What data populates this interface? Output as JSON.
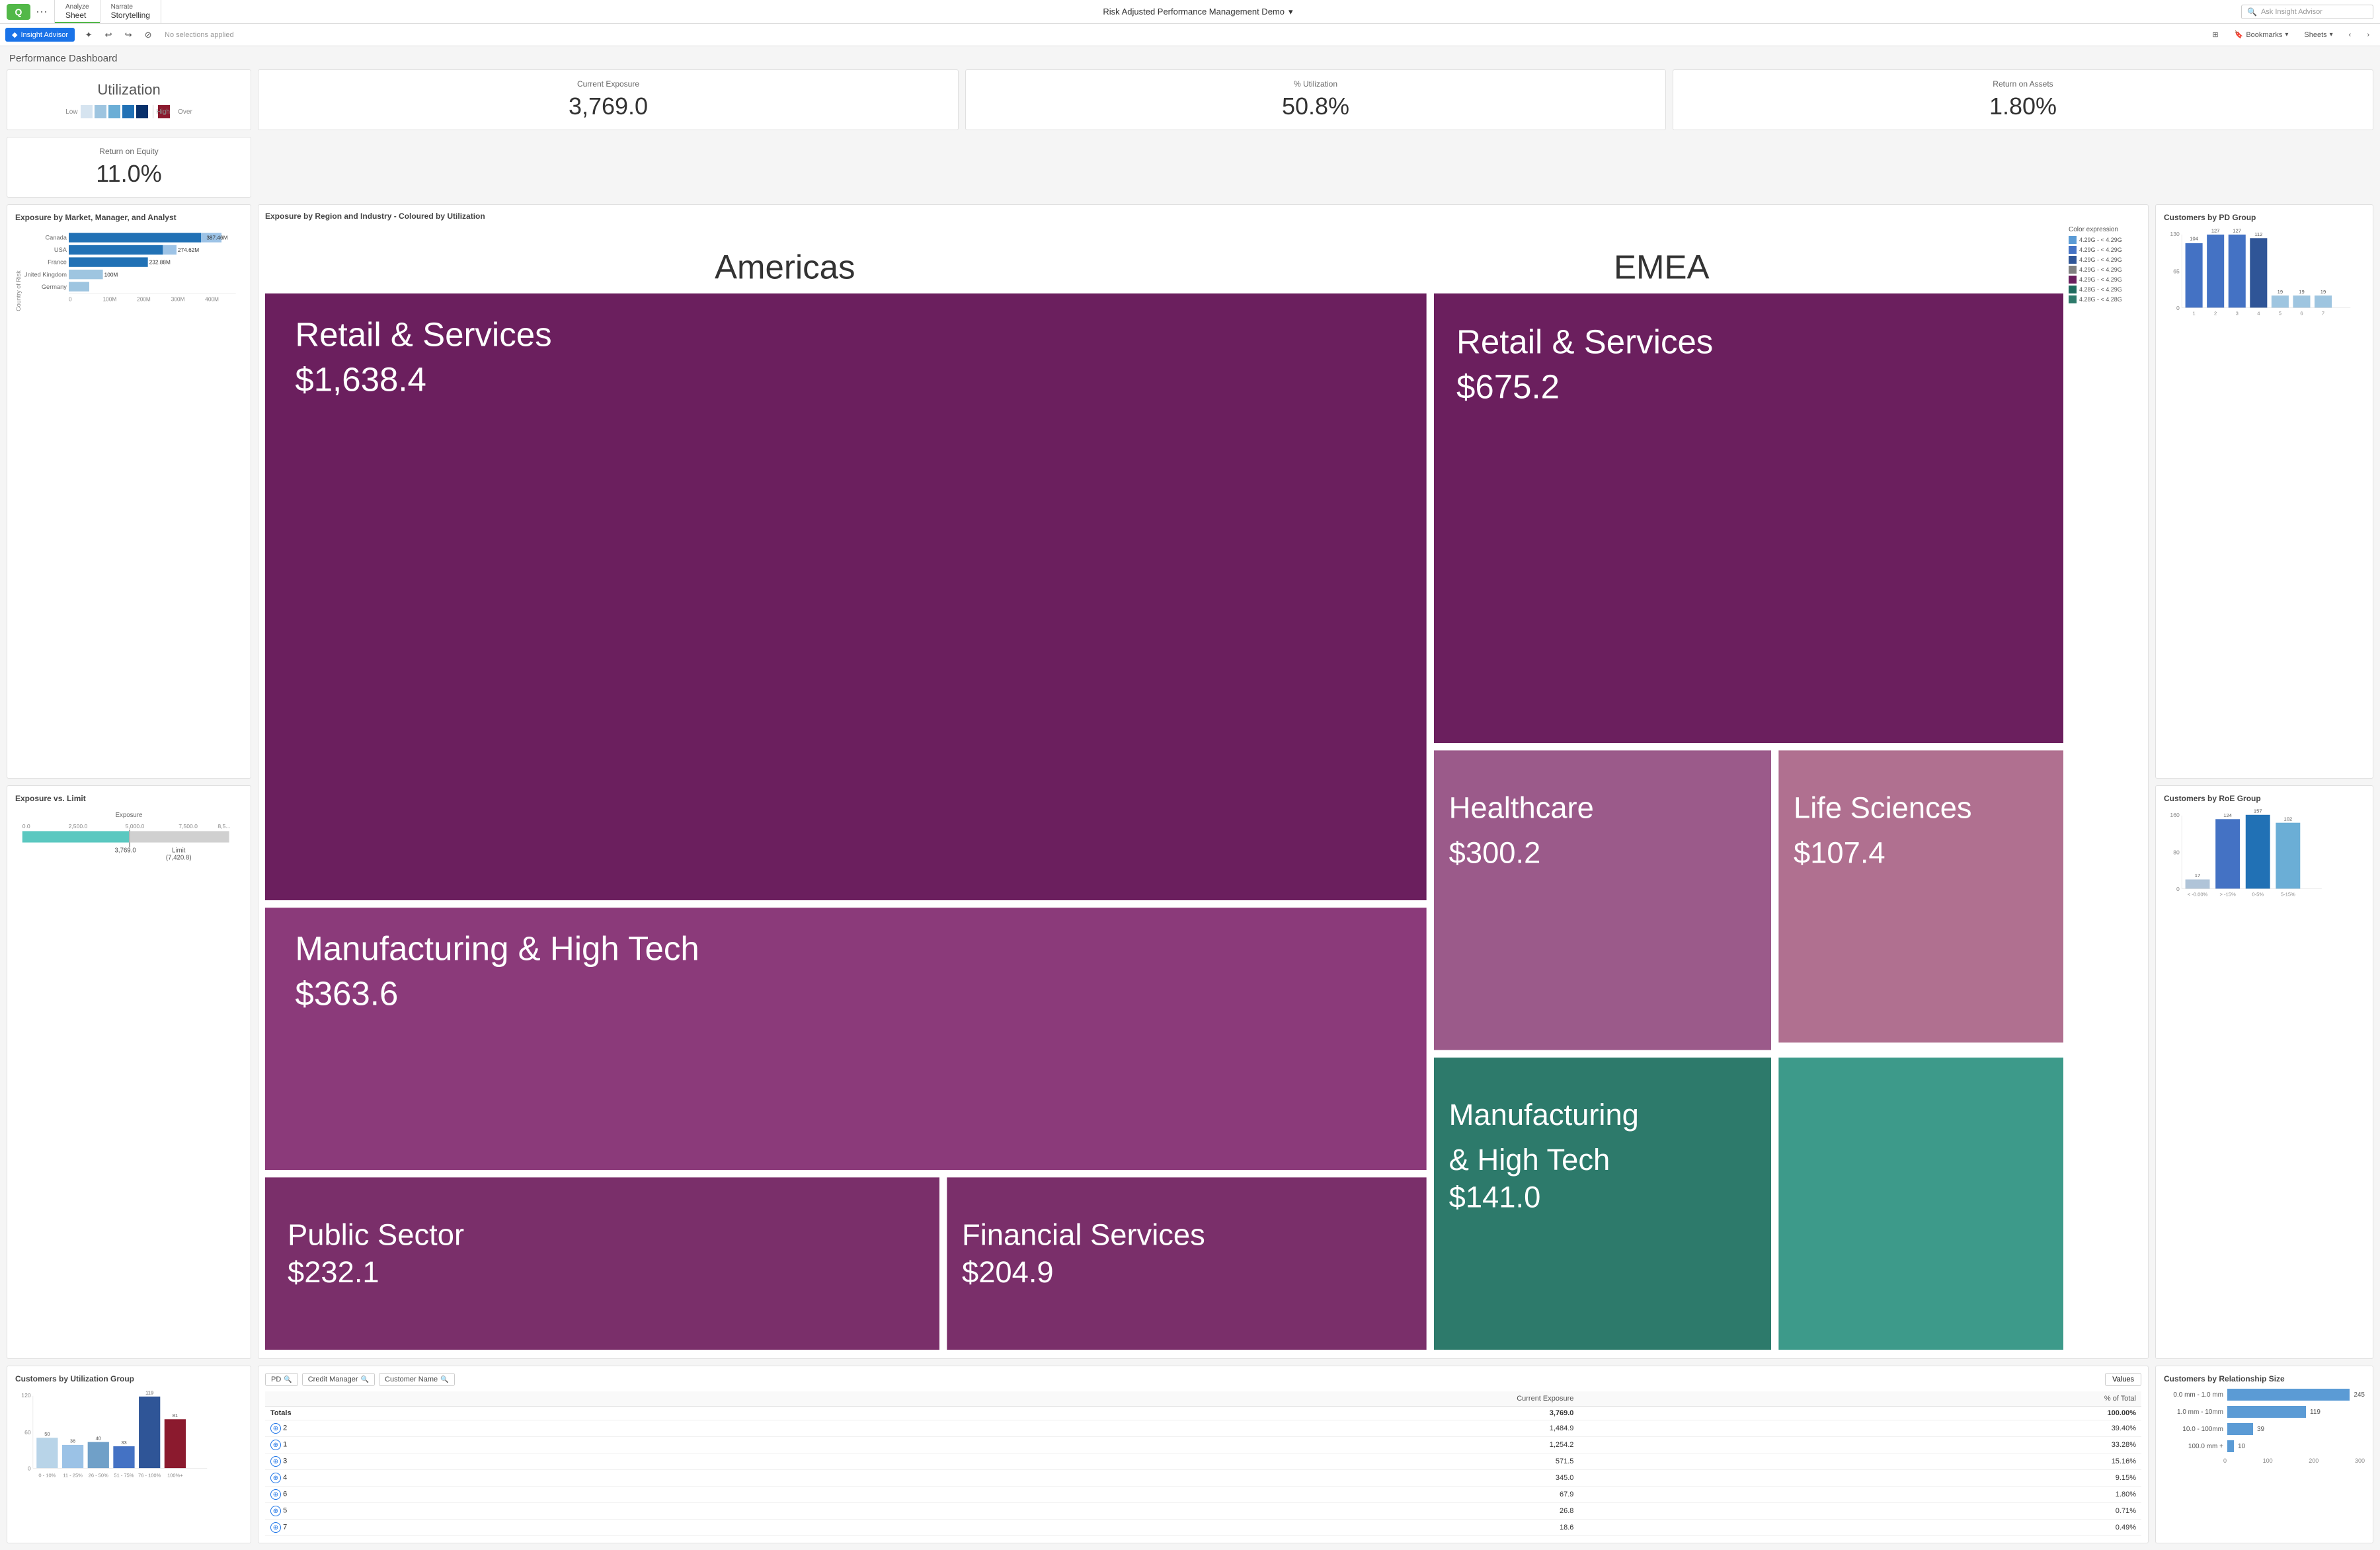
{
  "topNav": {
    "logo": "Q",
    "tabs": [
      {
        "top": "Analyze",
        "bottom": "Sheet",
        "active": true
      },
      {
        "top": "Narrate",
        "bottom": "Storytelling",
        "active": false
      }
    ],
    "title": "Risk Adjusted Performance Management Demo",
    "searchPlaceholder": "Ask Insight Advisor"
  },
  "toolbar": {
    "insightAdvisorLabel": "Insight Advisor",
    "noSelections": "No selections applied"
  },
  "bookmarks": "Bookmarks",
  "sheets": "Sheets",
  "pageTitle": "Performance Dashboard",
  "utilizationCard": {
    "title": "Utilization",
    "legend": {
      "low": "Low",
      "high": "High",
      "over": "Over"
    }
  },
  "kpis": [
    {
      "label": "Current Exposure",
      "value": "3,769.0"
    },
    {
      "label": "% Utilization",
      "value": "50.8%"
    },
    {
      "label": "Return on Assets",
      "value": "1.80%"
    },
    {
      "label": "Return on Equity",
      "value": "11.0%"
    }
  ],
  "exposureByMarket": {
    "title": "Exposure by Market, Manager, and Analyst",
    "axisLabel": "Country of Risk",
    "bars": [
      {
        "label": "Canada",
        "value": 387.46,
        "maxValue": 400,
        "displayValue": "387.46M"
      },
      {
        "label": "USA",
        "value": 274.62,
        "maxValue": 400,
        "displayValue": "274.62M"
      },
      {
        "label": "France",
        "value": 232.88,
        "maxValue": 400,
        "displayValue": "232.88M"
      },
      {
        "label": "United Kingdom",
        "value": 100,
        "maxValue": 400,
        "displayValue": "100M"
      },
      {
        "label": "Germany",
        "value": 60,
        "maxValue": 400,
        "displayValue": ""
      }
    ],
    "xLabels": [
      "0",
      "100M",
      "200M",
      "300M",
      "400M"
    ]
  },
  "exposureVsLimit": {
    "title": "Exposure vs. Limit",
    "exposureLabel": "Exposure",
    "xLabels": [
      "0.0",
      "2,500.0",
      "5,000.0",
      "7,500.0",
      "8,5..."
    ],
    "exposureValue": "3,769.0",
    "limitLabel": "Limit",
    "limitValue": "(7,420.8)"
  },
  "exposureByRegion": {
    "title": "Exposure by Region and Industry - Coloured by Utilization",
    "regions": {
      "americas": {
        "label": "Americas",
        "items": [
          {
            "label": "Retail & Services",
            "value": "$1,638.4",
            "colorClass": "dark-purple"
          },
          {
            "label": "Manufacturing & High Tech",
            "value": "$363.6",
            "colorClass": "medium-purple"
          },
          {
            "label": "Public Sector",
            "value": "$232.1",
            "colorClass": "medium-purple"
          },
          {
            "label": "Financial Services",
            "value": "$204.9",
            "colorClass": "medium-purple"
          }
        ]
      },
      "emea": {
        "label": "EMEA",
        "items": [
          {
            "label": "Retail & Services",
            "value": "$675.2",
            "colorClass": "dark-purple"
          },
          {
            "label": "Healthcare",
            "value": "$300.2",
            "colorClass": "light-purple"
          },
          {
            "label": "Manufacturing & High Tech",
            "value": "$141.0",
            "colorClass": "teal"
          },
          {
            "label": "Life Sciences",
            "value": "$107.4",
            "colorClass": "medium-light-purple"
          }
        ]
      }
    },
    "colorExpression": {
      "label": "Color expression",
      "items": [
        "4.29G - < 4.29G",
        "4.29G - < 4.29G",
        "4.29G - < 4.29G",
        "4.29G - < 4.29G",
        "4.29G - < 4.29G",
        "4.28G - < 4.29G",
        "4.28G - < 4.28G"
      ],
      "colors": [
        "#5b9bd5",
        "#4472c4",
        "#2f5597",
        "#7f7f7f",
        "#6b1f5e",
        "#1f6b5e",
        "#2d7a6b"
      ]
    }
  },
  "customersByPDGroup": {
    "title": "Customers by PD Group",
    "bars": [
      {
        "x": "1",
        "value": 104
      },
      {
        "x": "2",
        "value": 127
      },
      {
        "x": "3",
        "value": 127
      },
      {
        "x": "4",
        "value": 112
      },
      {
        "x": "5",
        "value": 19
      },
      {
        "x": "6",
        "value": 19
      },
      {
        "x": "7",
        "value": 19
      }
    ],
    "yMax": 130,
    "yLabels": [
      "0",
      "65",
      "130"
    ]
  },
  "customersByRoEGroup": {
    "title": "Customers by RoE Group",
    "bars": [
      {
        "x": "< -0.00%",
        "value": 17
      },
      {
        "x": "> -15%",
        "value": 124
      },
      {
        "x": "0-5%",
        "value": 157
      },
      {
        "x": "5-15%",
        "value": 102
      }
    ],
    "yMax": 160,
    "yLabels": [
      "0",
      "80",
      "160"
    ]
  },
  "customersByUtilGroup": {
    "title": "Customers by Utilization Group",
    "bars": [
      {
        "x": "0 - 10%",
        "value": 50,
        "color": "#b8d4e8"
      },
      {
        "x": "11 - 25%",
        "value": 36,
        "color": "#9bc2e6"
      },
      {
        "x": "26 - 50%",
        "value": 40,
        "color": "#70a0c8"
      },
      {
        "x": "51 - 75%",
        "value": 33,
        "color": "#4472c4"
      },
      {
        "x": "76 - 100%",
        "value": 119,
        "color": "#2f5597"
      },
      {
        "x": "100%+",
        "value": 81,
        "color": "#8b1a2e"
      }
    ],
    "yMax": 120,
    "yLabels": [
      "0",
      "60",
      "120"
    ]
  },
  "tableSection": {
    "filterPills": [
      {
        "label": "PD",
        "hasSearch": true
      },
      {
        "label": "Credit Manager",
        "hasSearch": true
      },
      {
        "label": "Customer Name",
        "hasSearch": true
      }
    ],
    "valuesBtn": "Values",
    "columns": [
      "",
      "Current Exposure",
      "% of Total"
    ],
    "totals": {
      "label": "Totals",
      "exposure": "3,769.0",
      "pct": "100.00%"
    },
    "rows": [
      {
        "pd": "2",
        "exposure": "1,484.9",
        "pct": "39.40%"
      },
      {
        "pd": "1",
        "exposure": "1,254.2",
        "pct": "33.28%"
      },
      {
        "pd": "3",
        "exposure": "571.5",
        "pct": "15.16%"
      },
      {
        "pd": "4",
        "exposure": "345.0",
        "pct": "9.15%"
      },
      {
        "pd": "6",
        "exposure": "67.9",
        "pct": "1.80%"
      },
      {
        "pd": "5",
        "exposure": "26.8",
        "pct": "0.71%"
      },
      {
        "pd": "7",
        "exposure": "18.6",
        "pct": "0.49%"
      }
    ]
  },
  "customersByRelSize": {
    "title": "Customers by Relationship Size",
    "bars": [
      {
        "label": "0.0 mm - 1.0 mm",
        "value": 245,
        "max": 300
      },
      {
        "label": "1.0 mm - 10mm",
        "value": 119,
        "max": 300
      },
      {
        "label": "10.0 - 100mm",
        "value": 39,
        "max": 300
      },
      {
        "label": "100.0 mm +",
        "value": 10,
        "max": 300
      }
    ],
    "xLabels": [
      "0",
      "100",
      "200",
      "300"
    ]
  }
}
